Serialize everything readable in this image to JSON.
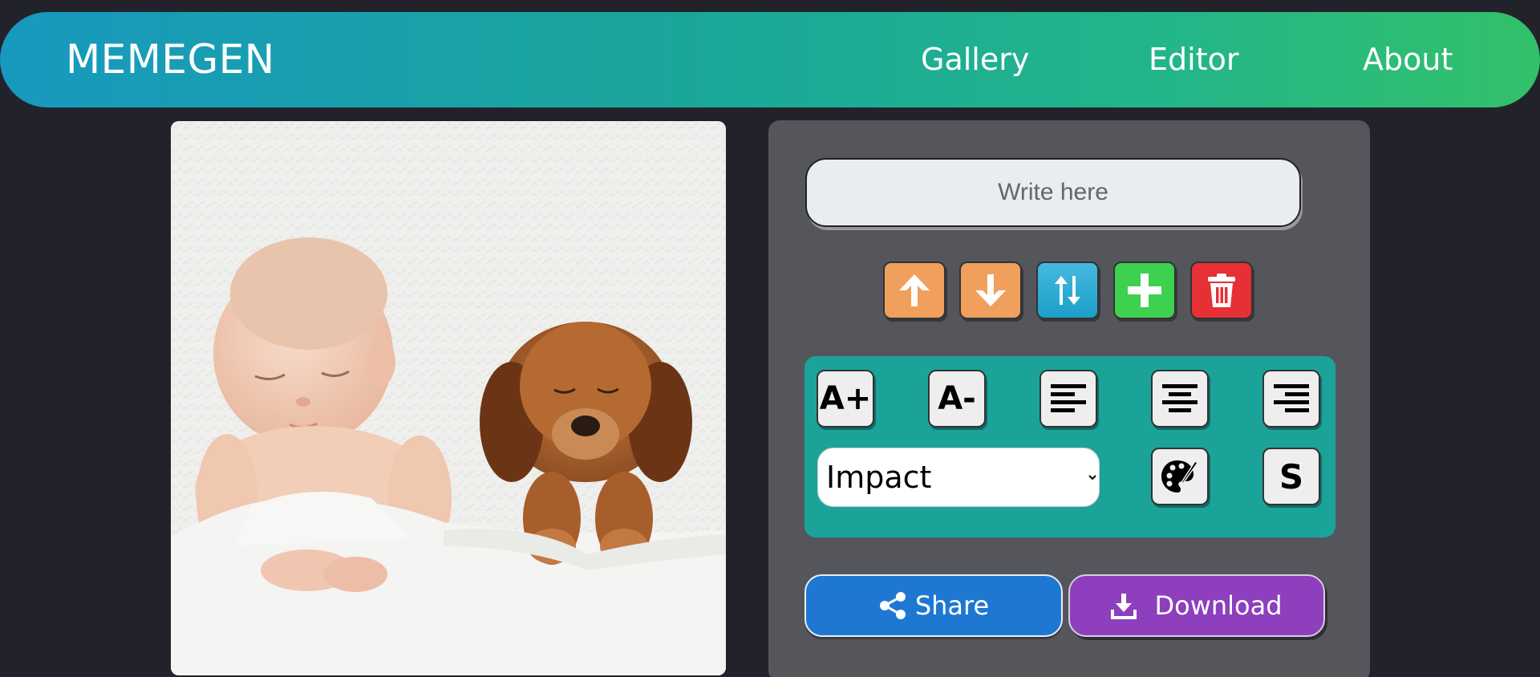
{
  "header": {
    "logo": "MEMEGEN",
    "nav": {
      "gallery": "Gallery",
      "editor": "Editor",
      "about": "About"
    }
  },
  "editor": {
    "text_input": {
      "placeholder": "Write here",
      "value": ""
    },
    "actions": [
      {
        "name": "move-line-up-button",
        "icon": "arrow-up-icon",
        "color": "#f0a05c"
      },
      {
        "name": "move-line-down-button",
        "icon": "arrow-down-icon",
        "color": "#f0a05c"
      },
      {
        "name": "switch-line-button",
        "icon": "swap-vertical-icon",
        "color": "#1ba0c8"
      },
      {
        "name": "add-line-button",
        "icon": "plus-icon",
        "color": "#3ed04f"
      },
      {
        "name": "delete-line-button",
        "icon": "trash-icon",
        "color": "#e63035"
      }
    ],
    "tools": {
      "increase_font_label": "A+",
      "decrease_font_label": "A-",
      "align_left_icon": "align-left-icon",
      "align_center_icon": "align-center-icon",
      "align_right_icon": "align-right-icon",
      "font_selected": "Impact",
      "color_icon": "palette-icon",
      "stroke_label": "S"
    },
    "share_label": "Share",
    "download_label": "Download"
  },
  "colors": {
    "background": "#22232a",
    "panel": "#55565b",
    "tools_panel": "#1ba39a",
    "share": "#1e78d2",
    "download": "#8d3fbd"
  }
}
